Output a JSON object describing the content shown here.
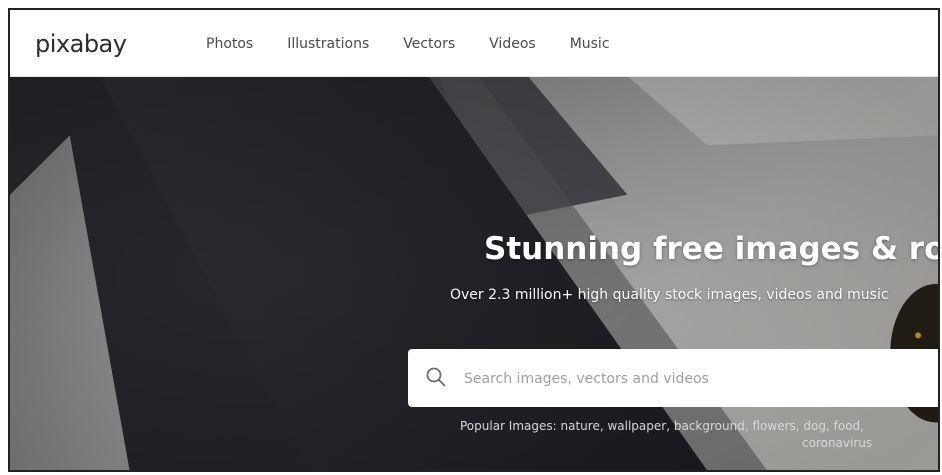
{
  "header": {
    "logo": "pixabay",
    "nav": [
      "Photos",
      "Illustrations",
      "Vectors",
      "Videos",
      "Music"
    ]
  },
  "hero": {
    "title": "Stunning free images & roy",
    "subtitle": "Over 2.3 million+ high quality stock images, videos and music",
    "search": {
      "placeholder": "Search images, vectors and videos",
      "icon": "search-icon"
    },
    "popular": {
      "prefix": "Popular Images: ",
      "tags": [
        "nature",
        "wallpaper",
        "background",
        "flowers",
        "dog",
        "food"
      ],
      "overflow_tag": "coronavirus"
    }
  },
  "colors": {
    "hero_dark": "#2a2a2e",
    "text_light": "#ffffff",
    "nav_text": "#4a4a4a"
  }
}
